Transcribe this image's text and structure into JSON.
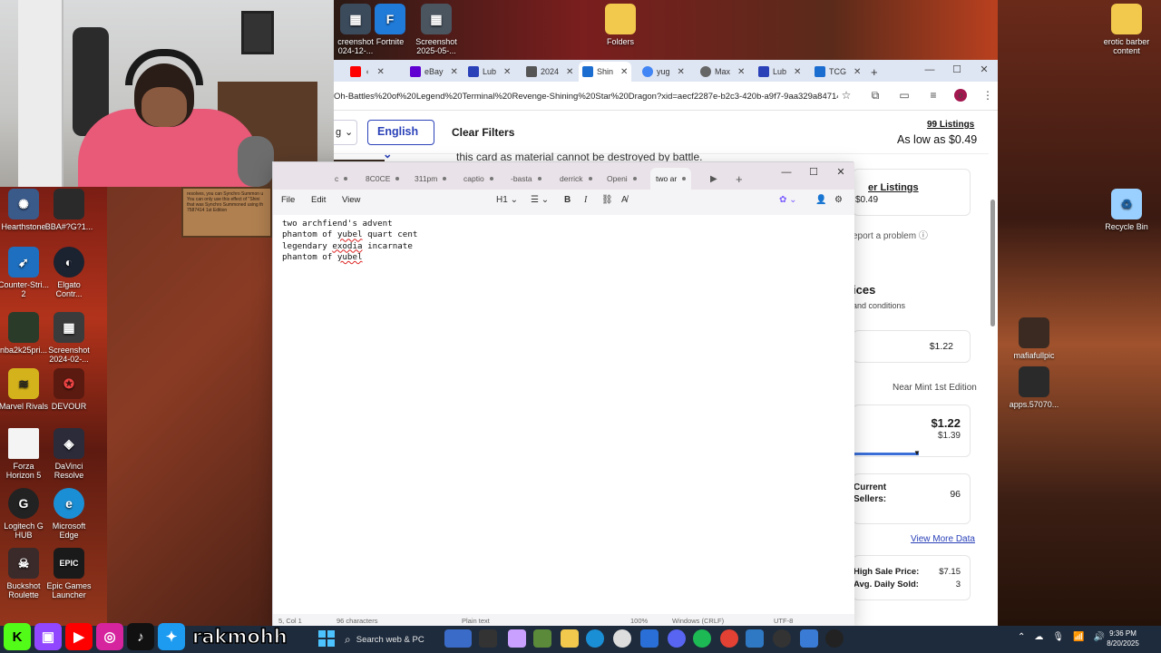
{
  "desktop": {
    "top_icons": [
      {
        "label": "creenshot\n024-12-...",
        "icon": "screenshot-icon"
      },
      {
        "label": "Fortnite",
        "icon": "fortnite-icon"
      },
      {
        "label": "Screenshot\n2025-05-...",
        "icon": "screenshot-icon"
      },
      {
        "label": "Folders",
        "icon": "folder-icon"
      },
      {
        "label": "erotic barber\ncontent",
        "icon": "folder-icon"
      }
    ],
    "left_icons": [
      {
        "label": "Hearthstone",
        "icon": "hearthstone-icon"
      },
      {
        "label": "BBA#?G?1...",
        "icon": "image-icon"
      },
      {
        "label": "Counter-Stri...\n2",
        "icon": "counter-strike-icon"
      },
      {
        "label": "Elgato\nContr...",
        "icon": "elgato-icon"
      },
      {
        "label": "nba2k25pri...",
        "icon": "nba-icon"
      },
      {
        "label": "Screenshot\n2024-02-...",
        "icon": "screenshot-icon"
      },
      {
        "label": "Marvel Rivals",
        "icon": "marvel-rivals-icon"
      },
      {
        "label": "DEVOUR",
        "icon": "devour-icon"
      },
      {
        "label": "Forza\nHorizon 5",
        "icon": "file-icon"
      },
      {
        "label": "DaVinci\nResolve",
        "icon": "davinci-icon"
      },
      {
        "label": "Logitech G\nHUB",
        "icon": "logitech-icon"
      },
      {
        "label": "Microsoft\nEdge",
        "icon": "edge-icon"
      },
      {
        "label": "Buckshot\nRoulette",
        "icon": "buckshot-icon"
      },
      {
        "label": "Epic Games\nLauncher",
        "icon": "epic-icon"
      }
    ],
    "right_icons": [
      {
        "label": "Recycle Bin",
        "icon": "recycle-bin-icon"
      },
      {
        "label": "mafiafullpic",
        "icon": "image-icon"
      },
      {
        "label": "apps.57070...",
        "icon": "image-icon"
      }
    ]
  },
  "browser": {
    "tabs": [
      {
        "label": "",
        "icon": "youtube-icon",
        "color": "#ff0000"
      },
      {
        "label": "eBay",
        "icon": "yahoo-icon",
        "color": "#6001d2"
      },
      {
        "label": "Lub",
        "icon": "tab-icon",
        "color": "#2a41b8"
      },
      {
        "label": "2024",
        "icon": "table-icon",
        "color": "#555555"
      },
      {
        "label": "Shin",
        "icon": "tcg-icon",
        "color": "#1c6dd0"
      },
      {
        "label": "yug",
        "icon": "google-icon",
        "color": "#4285f4"
      },
      {
        "label": "Max",
        "icon": "site-icon",
        "color": "#666666"
      },
      {
        "label": "Lub",
        "icon": "tab-icon",
        "color": "#2a41b8"
      },
      {
        "label": "TCG",
        "icon": "tcg-icon",
        "color": "#1c6dd0"
      }
    ],
    "url": "Oh-Battles%20of%20Legend%20Terminal%20Revenge-Shining%20Star%20Dragon?xid=aecf2287e-b2c3-420b-a9f7-9aa329a84714...",
    "filter": {
      "prev_label": "g",
      "language": "English",
      "clear_filters": "Clear Filters"
    },
    "listings_count": "99 Listings",
    "as_low_as": "As low as $0.49",
    "page_text": "this card as material cannot be destroyed by battle.",
    "card_text": "resolves, you can Synchro Summon u\nYou can only use this effect of \"Shini\nthat was Synchro Summoned using th\n7587414 1st Edition",
    "sidebar": {
      "seller_listings": "er Listings",
      "seller_price": "$0.49",
      "report": "eport a problem",
      "prices_heading": "ices",
      "prices_sub": "and conditions",
      "market_price": "$1.22",
      "condition": "Near Mint 1st Edition",
      "price_main": "$1.22",
      "price_sub": "$1.39",
      "current_sellers_label": "Current\nSellers:",
      "current_sellers_value": "96",
      "view_more": "View More Data",
      "high_sale_label": "High Sale Price:",
      "high_sale_value": "$7.15",
      "avg_daily_label": "Avg. Daily Sold:",
      "avg_daily_value": "3"
    }
  },
  "notepad": {
    "tabs": [
      "c",
      "8C0CE",
      "311pm",
      "captio",
      "-basta",
      "derrick",
      "Openi",
      "two ar"
    ],
    "active_tab": "two ar",
    "menu": {
      "file": "File",
      "edit": "Edit",
      "view": "View",
      "heading": "H1"
    },
    "lines": [
      {
        "parts": [
          {
            "t": "two archfiend's advent",
            "err": false
          }
        ]
      },
      {
        "parts": [
          {
            "t": "phantom of ",
            "err": false
          },
          {
            "t": "yubel",
            "err": true
          },
          {
            "t": " quart cent",
            "err": false
          }
        ]
      },
      {
        "parts": [
          {
            "t": "legendary ",
            "err": false
          },
          {
            "t": "exodia",
            "err": true
          },
          {
            "t": " incarnate",
            "err": false
          }
        ]
      },
      {
        "parts": [
          {
            "t": "phantom of ",
            "err": false
          },
          {
            "t": "yubel",
            "err": true
          }
        ]
      }
    ],
    "status": {
      "position": "5, Col 1",
      "characters": "96 characters",
      "format": "Plain text",
      "zoom": "100%",
      "line_ending": "Windows (CRLF)",
      "encoding": "UTF-8"
    }
  },
  "taskbar": {
    "handle": "rakmohh",
    "search_placeholder": "Search web & PC",
    "time": "9:36 PM",
    "date": "8/20/2025"
  },
  "colors": {
    "accent": "#2a41b8",
    "notepad_tab_bg": "#e9e2e8",
    "taskbar": "#1e2b3c"
  }
}
